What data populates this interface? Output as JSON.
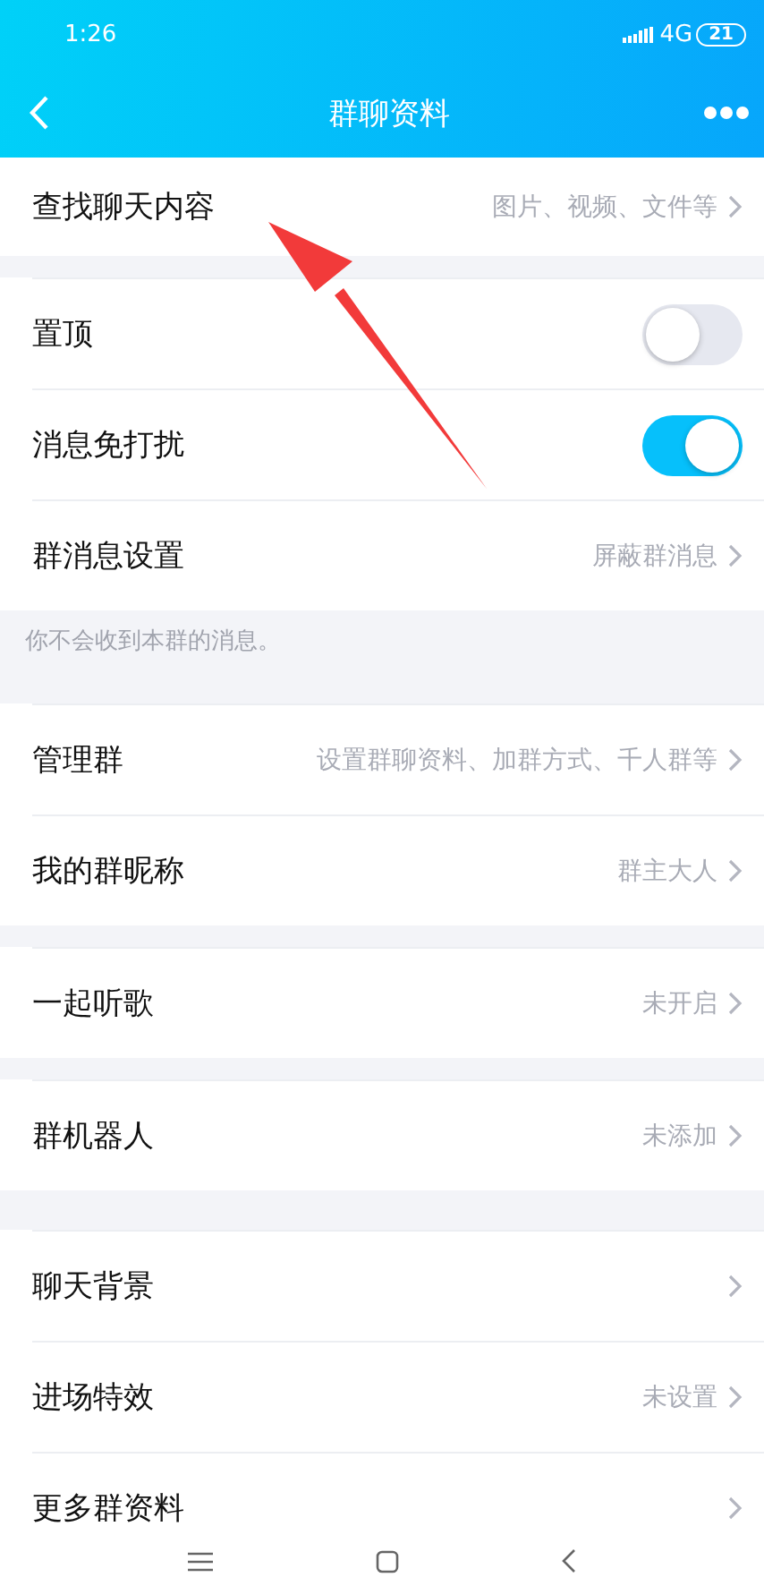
{
  "status_bar": {
    "time": "1:26",
    "network": "4G",
    "battery": "21"
  },
  "header": {
    "title": "群聊资料"
  },
  "groups": [
    {
      "rows": [
        {
          "kind": "link",
          "label": "查找聊天内容",
          "value": "图片、视频、文件等"
        }
      ]
    },
    {
      "rows": [
        {
          "kind": "toggle",
          "label": "置顶",
          "on": false
        },
        {
          "kind": "toggle",
          "label": "消息免打扰",
          "on": true
        },
        {
          "kind": "link",
          "label": "群消息设置",
          "value": "屏蔽群消息"
        }
      ],
      "note": "你不会收到本群的消息。"
    },
    {
      "rows": [
        {
          "kind": "link",
          "label": "管理群",
          "value": "设置群聊资料、加群方式、千人群等"
        },
        {
          "kind": "link",
          "label": "我的群昵称",
          "value": "群主大人"
        }
      ]
    },
    {
      "rows": [
        {
          "kind": "link",
          "label": "一起听歌",
          "value": "未开启"
        }
      ]
    },
    {
      "rows": [
        {
          "kind": "link",
          "label": "群机器人",
          "value": "未添加"
        }
      ]
    },
    {
      "rows": [
        {
          "kind": "link",
          "label": "聊天背景"
        },
        {
          "kind": "link",
          "label": "进场特效",
          "value": "未设置"
        },
        {
          "kind": "link",
          "label": "更多群资料"
        }
      ]
    }
  ],
  "annotation": {
    "kind": "arrow"
  }
}
